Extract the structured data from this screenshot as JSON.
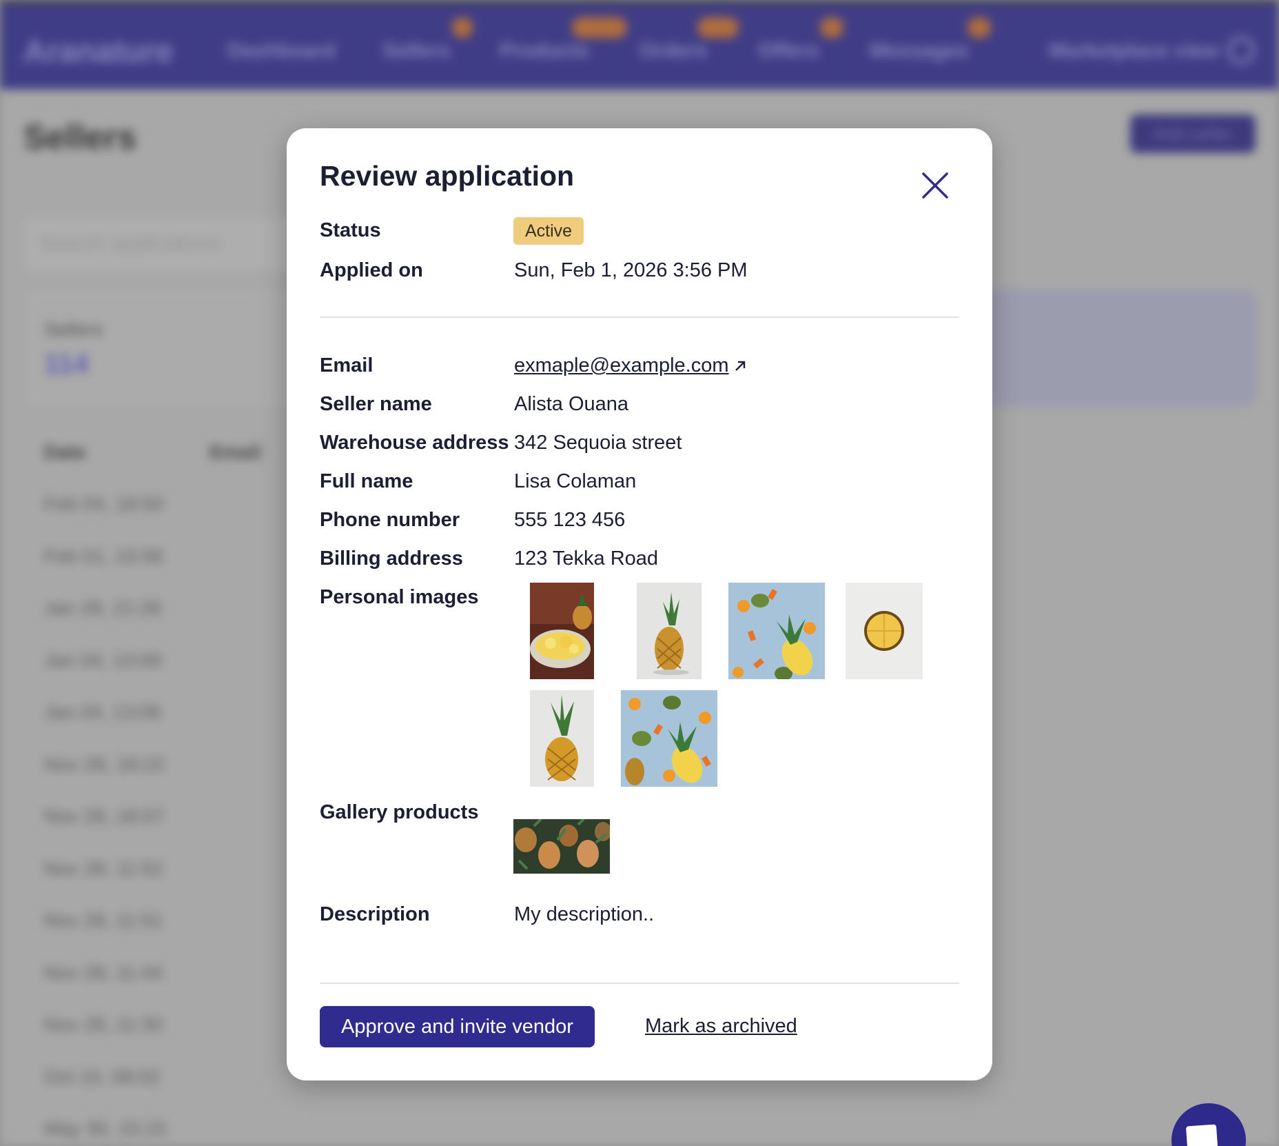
{
  "app": {
    "brand": "Aranature",
    "nav": [
      "Dashboard",
      "Sellers",
      "Products",
      "Orders",
      "Offers",
      "Messages",
      "Marketplace view"
    ],
    "page_title": "Sellers",
    "add_button": "Add seller",
    "search_placeholder": "Search applications",
    "stat_label": "Sellers",
    "stat_value": "114",
    "table_headers": [
      "Date",
      "Email"
    ],
    "table_dates": [
      "Feb 04, 18:50",
      "Feb 01, 15:56",
      "Jan 28, 21:28",
      "Jan 04, 13:09",
      "Jan 04, 13:06",
      "Nov 28, 18:22",
      "Nov 28, 18:07",
      "Nov 28, 11:52",
      "Nov 28, 11:51",
      "Nov 28, 11:44",
      "Nov 28, 11:30",
      "Oct 15, 08:02",
      "May 30, 15:15"
    ]
  },
  "modal": {
    "title": "Review application",
    "status_label": "Status",
    "status_value": "Active",
    "applied_label": "Applied on",
    "applied_value": "Sun, Feb 1, 2026 3:56 PM",
    "email_label": "Email",
    "email_value": "exmaple@example.com",
    "seller_name_label": "Seller name",
    "seller_name_value": "Alista Ouana",
    "warehouse_label": "Warehouse address",
    "warehouse_value": "342 Sequoia street",
    "full_name_label": "Full name",
    "full_name_value": "Lisa Colaman",
    "phone_label": "Phone number",
    "phone_value": "555 123 456",
    "billing_label": "Billing address",
    "billing_value": "123 Tekka Road",
    "personal_images_label": "Personal images",
    "gallery_label": "Gallery products",
    "description_label": "Description",
    "description_value": "My description..",
    "approve_button": "Approve and invite vendor",
    "archive_link": "Mark as archived"
  },
  "colors": {
    "brand": "#2e2a8c",
    "primary_button": "#2f2b8f",
    "status_badge": "#f0cd7e"
  },
  "icons": [
    "close-icon",
    "external-link-icon",
    "gear-icon",
    "chat-icon"
  ]
}
